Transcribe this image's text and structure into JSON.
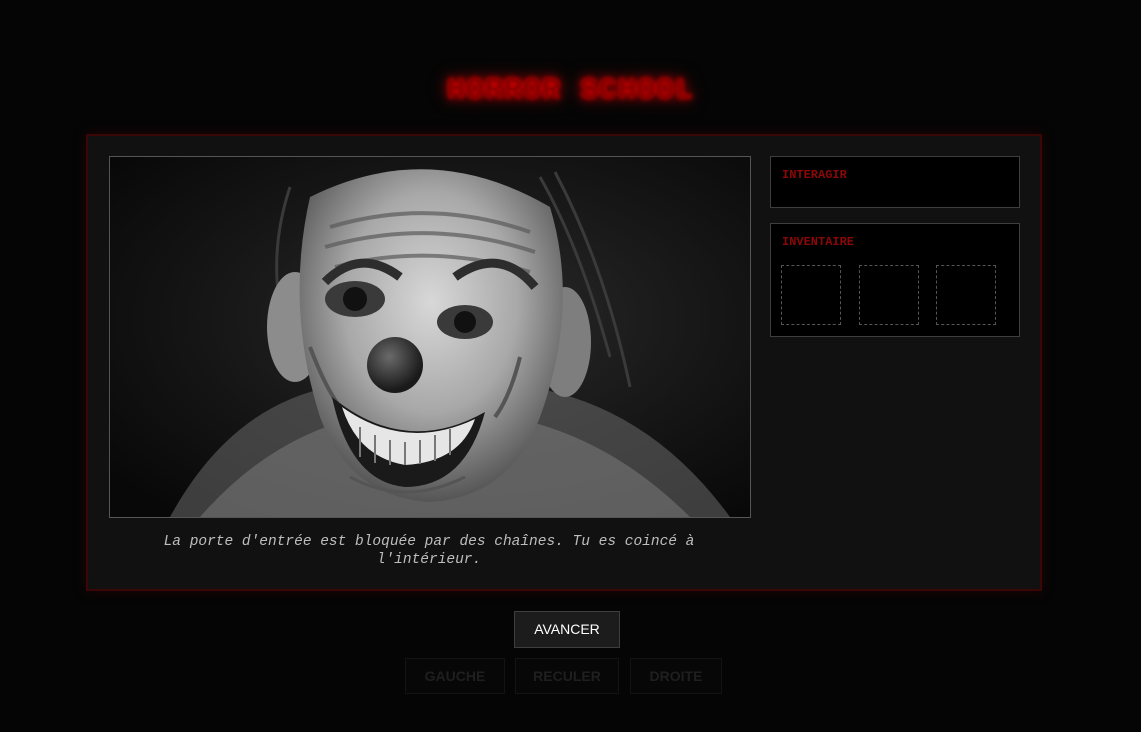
{
  "title": "HORROR SCHOOL",
  "scene": {
    "image_alt": "clown mask",
    "caption": "La porte d'entrée est bloquée par des chaînes. Tu es coincé à l'intérieur."
  },
  "panels": {
    "interact_label": "INTERAGIR",
    "inventory_label": "INVENTAIRE",
    "inventory_slots": [
      "",
      "",
      ""
    ]
  },
  "controls": {
    "forward": "AVANCER",
    "left": "GAUCHE",
    "back": "RECULER",
    "right": "DROITE"
  },
  "colors": {
    "accent": "#8c0808",
    "title_glow": "#ff0000",
    "background": "#050505",
    "panel": "#111111"
  }
}
